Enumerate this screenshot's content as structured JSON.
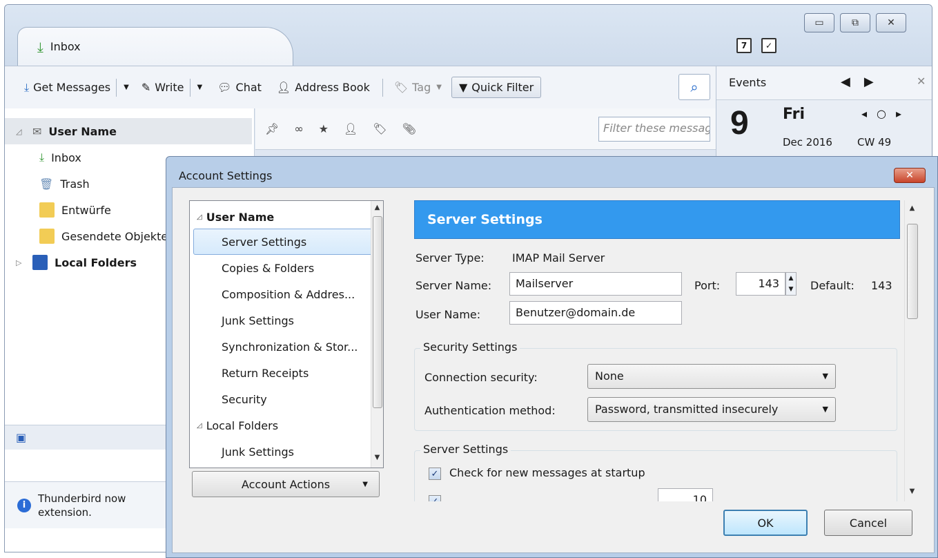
{
  "main_window": {
    "tab_title": "Inbox",
    "window_buttons": [
      "▭",
      "⧉",
      "✕"
    ],
    "toolbar": {
      "get_messages": "Get Messages",
      "write": "Write",
      "chat": "Chat",
      "address_book": "Address Book",
      "tag": "Tag",
      "quick_filter": "Quick Filter"
    },
    "folders": {
      "account": "User Name",
      "inbox": "Inbox",
      "trash": "Trash",
      "drafts": "Entwürfe",
      "sent": "Gesendete Objekte",
      "local": "Local Folders"
    },
    "filter_placeholder": "Filter these messages",
    "notice_text_1": "Thunderbird now",
    "notice_text_2": "extension."
  },
  "events": {
    "title": "Events",
    "day": "9",
    "weekday": "Fri",
    "month_year": "Dec 2016",
    "cw": "CW 49"
  },
  "dialog": {
    "title": "Account Settings",
    "close_label": "✕",
    "tree": {
      "account_label": "User Name",
      "items": [
        "Server Settings",
        "Copies & Folders",
        "Composition & Addres...",
        "Junk Settings",
        "Synchronization & Stor...",
        "Return Receipts",
        "Security"
      ],
      "local_label": "Local Folders",
      "local_items": [
        "Junk Settings"
      ]
    },
    "account_actions": "Account Actions",
    "panel": {
      "header": "Server Settings",
      "server_type_label": "Server Type:",
      "server_type_value": "IMAP Mail Server",
      "server_name_label": "Server Name:",
      "server_name_value": "Mailserver",
      "port_label": "Port:",
      "port_value": "143",
      "default_label": "Default:",
      "default_value": "143",
      "user_name_label": "User Name:",
      "user_name_value": "Benutzer@domain.de",
      "security_group": "Security Settings",
      "connection_security_label": "Connection security:",
      "connection_security_value": "None",
      "auth_method_label": "Authentication method:",
      "auth_method_value": "Password, transmitted insecurely",
      "server_group": "Server Settings",
      "check_startup_label": "Check for new messages at startup",
      "check_startup_checked": true,
      "check_every_value": "10"
    },
    "ok": "OK",
    "cancel": "Cancel"
  }
}
